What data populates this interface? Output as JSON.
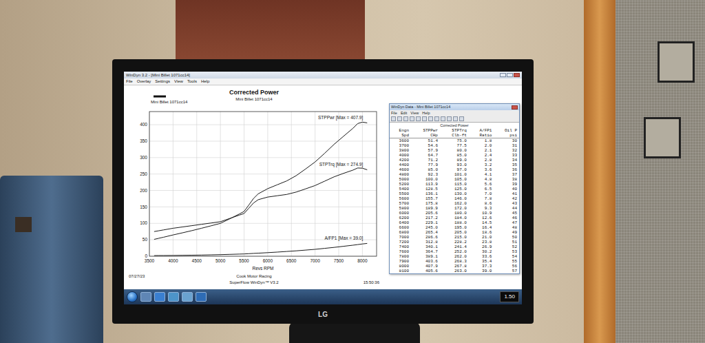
{
  "monitor": {
    "brand": "LG"
  },
  "graph_window": {
    "title": "WinDyn 3.2 - [Mini Billet 1071cc14]",
    "menu": [
      "File",
      "Overlay",
      "Settings",
      "View",
      "Tools",
      "Help"
    ]
  },
  "chart": {
    "title": "Corrected Power",
    "subtitle": "Mini Billet 1071cc14",
    "legend": "Mini Billet 1071cc14",
    "y_ticks": [
      "0",
      "50",
      "100",
      "150",
      "200",
      "250",
      "300",
      "350",
      "400"
    ],
    "x_ticks": [
      "3500",
      "4000",
      "4500",
      "5000",
      "5500",
      "6000",
      "6500",
      "7000",
      "7500",
      "8000"
    ],
    "x_label": "Revs  RPM",
    "rpm": [
      3600,
      3700,
      3800,
      4000,
      4200,
      4400,
      4600,
      4800,
      5000,
      5200,
      5400,
      5500,
      5600,
      5700,
      5800,
      6000,
      6200,
      6400,
      6600,
      6800,
      7000,
      7200,
      7400,
      7600,
      7800,
      7900,
      8000,
      8100
    ],
    "series": [
      {
        "label": "STPPwr [Max = 407.9]",
        "values": [
          51.4,
          54.6,
          57.9,
          64.7,
          71.2,
          77.9,
          85.0,
          92.3,
          100.0,
          113.9,
          128.5,
          136.1,
          155.7,
          175.8,
          189.9,
          205.6,
          217.2,
          229.1,
          245.0,
          265.4,
          286.6,
          312.8,
          340.1,
          364.7,
          389.1,
          403.6,
          407.9,
          405.6
        ]
      },
      {
        "label": "STPTrq [Max = 274.9]",
        "values": [
          75.0,
          77.5,
          80.0,
          85.0,
          89.0,
          93.0,
          97.0,
          101.0,
          105.0,
          115.0,
          125.0,
          130.0,
          146.0,
          162.0,
          172.0,
          180.0,
          184.0,
          188.0,
          195.0,
          205.0,
          215.0,
          228.2,
          241.4,
          252.0,
          262.0,
          268.3,
          267.8,
          263.0
        ]
      },
      {
        "label": "A/FP1 [Max = 39.0]",
        "values": [
          1.8,
          2.0,
          2.1,
          2.4,
          2.8,
          3.2,
          3.6,
          4.1,
          4.8,
          5.6,
          6.5,
          7.0,
          7.8,
          8.6,
          9.3,
          10.9,
          12.6,
          14.5,
          16.4,
          18.6,
          21.0,
          23.8,
          26.9,
          30.2,
          33.6,
          35.4,
          37.3,
          39.0
        ]
      }
    ],
    "footer": {
      "date": "07/27/23",
      "company": "Cook Motor Racing",
      "software": "SuperFlow WinDyn™ V3.2",
      "time": "15:50:36"
    }
  },
  "data_window": {
    "title": "WinDyn Data - Mini Billet 1071cc14",
    "menu": [
      "File",
      "Edit",
      "View",
      "Help"
    ],
    "section": "Corrected Power",
    "columns": [
      {
        "name": "Engn",
        "unit": "Spd"
      },
      {
        "name": "STPPwr",
        "unit": "CHp"
      },
      {
        "name": "STPTrq",
        "unit": "Clb-ft"
      },
      {
        "name": "A/FP1",
        "unit": "Ratio"
      },
      {
        "name": "Oil P",
        "unit": "psi"
      }
    ],
    "rows": [
      [
        "3600",
        "51.4",
        "75.0",
        "1.8",
        "30"
      ],
      [
        "3700",
        "54.6",
        "77.5",
        "2.0",
        "31"
      ],
      [
        "3800",
        "57.9",
        "80.0",
        "2.1",
        "32"
      ],
      [
        "4000",
        "64.7",
        "85.0",
        "2.4",
        "33"
      ],
      [
        "4200",
        "71.2",
        "89.0",
        "2.8",
        "34"
      ],
      [
        "4400",
        "77.9",
        "93.0",
        "3.2",
        "35"
      ],
      [
        "4600",
        "85.0",
        "97.0",
        "3.6",
        "36"
      ],
      [
        "4800",
        "92.3",
        "101.0",
        "4.1",
        "37"
      ],
      [
        "5000",
        "100.0",
        "105.0",
        "4.8",
        "38"
      ],
      [
        "5200",
        "113.9",
        "115.0",
        "5.6",
        "39"
      ],
      [
        "5400",
        "128.5",
        "125.0",
        "6.5",
        "40"
      ],
      [
        "5500",
        "136.1",
        "130.0",
        "7.0",
        "41"
      ],
      [
        "5600",
        "155.7",
        "146.0",
        "7.8",
        "42"
      ],
      [
        "5700",
        "175.8",
        "162.0",
        "8.6",
        "43"
      ],
      [
        "5800",
        "189.9",
        "172.0",
        "9.3",
        "44"
      ],
      [
        "6000",
        "205.6",
        "180.0",
        "10.9",
        "45"
      ],
      [
        "6200",
        "217.2",
        "184.0",
        "12.6",
        "46"
      ],
      [
        "6400",
        "229.1",
        "188.0",
        "14.5",
        "47"
      ],
      [
        "6600",
        "245.0",
        "195.0",
        "16.4",
        "48"
      ],
      [
        "6800",
        "265.4",
        "205.0",
        "18.6",
        "49"
      ],
      [
        "7000",
        "286.6",
        "215.0",
        "21.0",
        "50"
      ],
      [
        "7200",
        "312.8",
        "228.2",
        "23.8",
        "51"
      ],
      [
        "7400",
        "340.1",
        "241.4",
        "26.9",
        "52"
      ],
      [
        "7600",
        "364.7",
        "252.0",
        "30.2",
        "53"
      ],
      [
        "7800",
        "389.1",
        "262.0",
        "33.6",
        "54"
      ],
      [
        "7900",
        "403.6",
        "268.3",
        "35.4",
        "55"
      ],
      [
        "8000",
        "407.9",
        "267.8",
        "37.3",
        "56"
      ],
      [
        "8100",
        "405.6",
        "263.0",
        "39.0",
        "57"
      ]
    ]
  },
  "taskbar": {
    "clock": "1.50"
  }
}
